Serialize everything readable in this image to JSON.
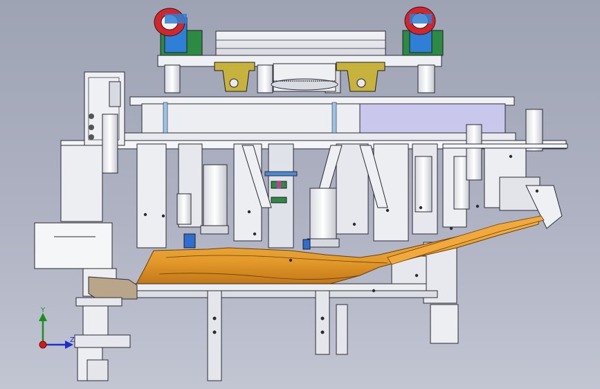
{
  "viewport": {
    "background_top": "#9ea3b4",
    "background_bottom": "#c2c5d2"
  },
  "triad": {
    "y_label": "Y",
    "z_label": "Z",
    "y_color": "#1e8c1e",
    "z_color": "#1a2fd0",
    "x_color": "#d01a1a"
  },
  "palette": {
    "frame": "#e6e7ec",
    "frame_shade": "#c9cbd4",
    "edge": "#2a2a33",
    "part_orange": "#e39a2a",
    "part_orange_dark": "#b86d12",
    "roller_red": "#d4252a",
    "roller_blue": "#2f7fd6",
    "bracket_yellow": "#c8b23e",
    "green_plate": "#2c8a43",
    "lavender": "#c9c8ec"
  }
}
